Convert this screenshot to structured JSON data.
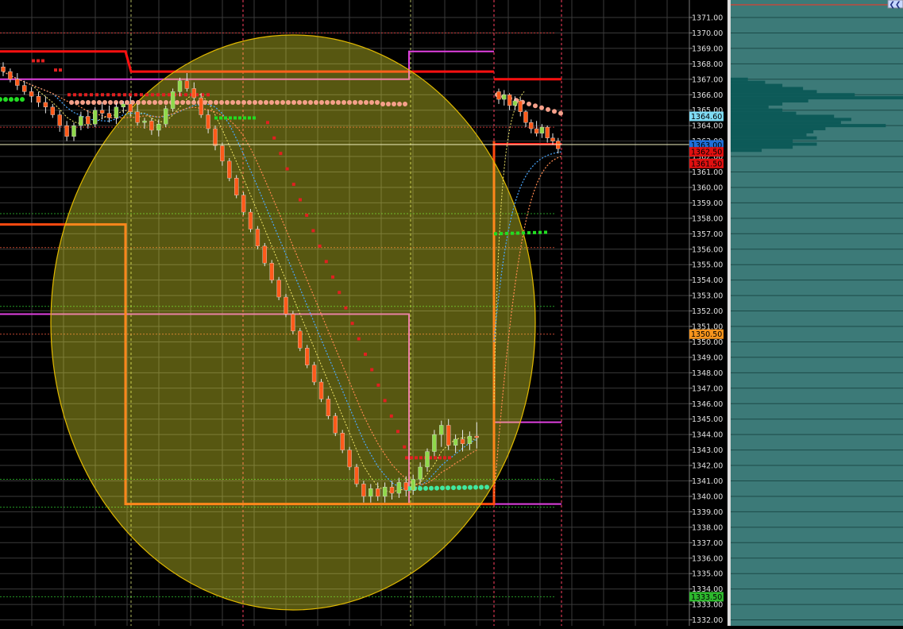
{
  "chart_data": {
    "type": "candlestick",
    "y_axis": {
      "min": 1332.0,
      "max": 1371.0,
      "tick_step": 1.0,
      "position": "right",
      "tick_labels": [
        "1371.00",
        "1370.00",
        "1369.00",
        "1368.00",
        "1367.00",
        "1366.00",
        "1365.00",
        "1364.00",
        "1363.00",
        "1362.00",
        "1361.00",
        "1360.00",
        "1359.00",
        "1358.00",
        "1357.00",
        "1356.00",
        "1355.00",
        "1354.00",
        "1353.00",
        "1352.00",
        "1351.00",
        "1350.00",
        "1349.00",
        "1348.00",
        "1347.00",
        "1346.00",
        "1345.00",
        "1344.00",
        "1343.00",
        "1342.00",
        "1341.00",
        "1340.00",
        "1339.00",
        "1338.00",
        "1337.00",
        "1336.00",
        "1335.00",
        "1334.00",
        "1333.00",
        "1332.00"
      ]
    },
    "grid": true,
    "price_markers": [
      {
        "label": "1364.60",
        "value": 1364.6,
        "color": "#7fdcf5",
        "text_color": "#000000"
      },
      {
        "label": "1363.00",
        "value": 1362.75,
        "color": "#1e6fd9",
        "text_color": "#000000"
      },
      {
        "label": "1362.50",
        "value": 1362.3,
        "color": "#e01010",
        "text_color": "#000000"
      },
      {
        "label": "1361.50",
        "value": 1361.55,
        "color": "#e01010",
        "text_color": "#000000"
      },
      {
        "label": "1350.50",
        "value": 1350.5,
        "color": "#f7941d",
        "text_color": "#000000"
      },
      {
        "label": "1333.50",
        "value": 1333.5,
        "color": "#2db82d",
        "text_color": "#000000"
      }
    ],
    "candles": [
      {
        "o": 1367.8,
        "h": 1368.1,
        "l": 1367.2,
        "c": 1367.5
      },
      {
        "o": 1367.5,
        "h": 1367.7,
        "l": 1366.8,
        "c": 1367.0
      },
      {
        "o": 1367.0,
        "h": 1367.4,
        "l": 1366.3,
        "c": 1366.6
      },
      {
        "o": 1366.6,
        "h": 1366.9,
        "l": 1366.0,
        "c": 1366.2
      },
      {
        "o": 1366.2,
        "h": 1366.5,
        "l": 1365.5,
        "c": 1365.9
      },
      {
        "o": 1365.9,
        "h": 1366.2,
        "l": 1365.2,
        "c": 1365.5
      },
      {
        "o": 1365.5,
        "h": 1365.9,
        "l": 1364.8,
        "c": 1365.2
      },
      {
        "o": 1365.2,
        "h": 1365.4,
        "l": 1364.5,
        "c": 1364.7
      },
      {
        "o": 1364.7,
        "h": 1365.0,
        "l": 1363.6,
        "c": 1364.0
      },
      {
        "o": 1364.0,
        "h": 1364.3,
        "l": 1363.0,
        "c": 1363.3
      },
      {
        "o": 1363.3,
        "h": 1364.2,
        "l": 1363.0,
        "c": 1364.0
      },
      {
        "o": 1364.0,
        "h": 1364.9,
        "l": 1363.7,
        "c": 1364.6
      },
      {
        "o": 1364.6,
        "h": 1365.0,
        "l": 1363.8,
        "c": 1364.1
      },
      {
        "o": 1364.1,
        "h": 1365.2,
        "l": 1363.9,
        "c": 1365.0
      },
      {
        "o": 1365.0,
        "h": 1365.5,
        "l": 1364.4,
        "c": 1364.8
      },
      {
        "o": 1364.8,
        "h": 1365.3,
        "l": 1364.2,
        "c": 1364.5
      },
      {
        "o": 1364.5,
        "h": 1365.5,
        "l": 1364.1,
        "c": 1365.2
      },
      {
        "o": 1365.2,
        "h": 1365.6,
        "l": 1364.8,
        "c": 1365.4
      },
      {
        "o": 1365.4,
        "h": 1365.9,
        "l": 1364.6,
        "c": 1364.9
      },
      {
        "o": 1364.9,
        "h": 1365.4,
        "l": 1364.0,
        "c": 1364.2
      },
      {
        "o": 1364.2,
        "h": 1364.5,
        "l": 1363.8,
        "c": 1364.3
      },
      {
        "o": 1364.3,
        "h": 1364.5,
        "l": 1363.4,
        "c": 1363.7
      },
      {
        "o": 1363.7,
        "h": 1364.4,
        "l": 1363.3,
        "c": 1364.1
      },
      {
        "o": 1364.1,
        "h": 1365.3,
        "l": 1363.9,
        "c": 1365.1
      },
      {
        "o": 1365.1,
        "h": 1366.4,
        "l": 1364.9,
        "c": 1366.2
      },
      {
        "o": 1366.2,
        "h": 1367.1,
        "l": 1365.9,
        "c": 1366.9
      },
      {
        "o": 1366.9,
        "h": 1367.4,
        "l": 1366.2,
        "c": 1366.4
      },
      {
        "o": 1366.4,
        "h": 1366.8,
        "l": 1365.6,
        "c": 1365.8
      },
      {
        "o": 1365.8,
        "h": 1366.1,
        "l": 1364.5,
        "c": 1364.7
      },
      {
        "o": 1364.7,
        "h": 1365.0,
        "l": 1363.5,
        "c": 1363.8
      },
      {
        "o": 1363.8,
        "h": 1364.0,
        "l": 1362.4,
        "c": 1362.7
      },
      {
        "o": 1362.7,
        "h": 1362.9,
        "l": 1361.4,
        "c": 1361.7
      },
      {
        "o": 1361.7,
        "h": 1361.9,
        "l": 1360.4,
        "c": 1360.6
      },
      {
        "o": 1360.6,
        "h": 1360.8,
        "l": 1359.3,
        "c": 1359.5
      },
      {
        "o": 1359.5,
        "h": 1359.7,
        "l": 1358.2,
        "c": 1358.4
      },
      {
        "o": 1358.4,
        "h": 1358.6,
        "l": 1357.1,
        "c": 1357.3
      },
      {
        "o": 1357.3,
        "h": 1357.5,
        "l": 1356.0,
        "c": 1356.2
      },
      {
        "o": 1356.2,
        "h": 1356.4,
        "l": 1354.9,
        "c": 1355.1
      },
      {
        "o": 1355.1,
        "h": 1355.3,
        "l": 1353.8,
        "c": 1354.0
      },
      {
        "o": 1354.0,
        "h": 1354.2,
        "l": 1352.7,
        "c": 1352.9
      },
      {
        "o": 1352.9,
        "h": 1353.1,
        "l": 1351.6,
        "c": 1351.8
      },
      {
        "o": 1351.8,
        "h": 1352.0,
        "l": 1350.5,
        "c": 1350.7
      },
      {
        "o": 1350.7,
        "h": 1350.9,
        "l": 1349.4,
        "c": 1349.6
      },
      {
        "o": 1349.6,
        "h": 1349.8,
        "l": 1348.3,
        "c": 1348.5
      },
      {
        "o": 1348.5,
        "h": 1348.7,
        "l": 1347.2,
        "c": 1347.4
      },
      {
        "o": 1347.4,
        "h": 1347.6,
        "l": 1346.1,
        "c": 1346.3
      },
      {
        "o": 1346.3,
        "h": 1346.5,
        "l": 1345.0,
        "c": 1345.2
      },
      {
        "o": 1345.2,
        "h": 1345.4,
        "l": 1343.9,
        "c": 1344.1
      },
      {
        "o": 1344.1,
        "h": 1344.3,
        "l": 1342.8,
        "c": 1343.0
      },
      {
        "o": 1343.0,
        "h": 1343.2,
        "l": 1341.7,
        "c": 1341.9
      },
      {
        "o": 1341.9,
        "h": 1342.1,
        "l": 1340.6,
        "c": 1340.8
      },
      {
        "o": 1340.8,
        "h": 1341.0,
        "l": 1339.6,
        "c": 1340.0
      },
      {
        "o": 1340.0,
        "h": 1340.8,
        "l": 1339.6,
        "c": 1340.5
      },
      {
        "o": 1340.5,
        "h": 1340.9,
        "l": 1339.7,
        "c": 1340.0
      },
      {
        "o": 1340.0,
        "h": 1340.9,
        "l": 1339.6,
        "c": 1340.6
      },
      {
        "o": 1340.6,
        "h": 1341.0,
        "l": 1339.8,
        "c": 1340.2
      },
      {
        "o": 1340.2,
        "h": 1341.2,
        "l": 1339.9,
        "c": 1340.9
      },
      {
        "o": 1340.9,
        "h": 1341.3,
        "l": 1340.0,
        "c": 1340.4
      },
      {
        "o": 1340.4,
        "h": 1341.4,
        "l": 1340.1,
        "c": 1341.1
      },
      {
        "o": 1341.1,
        "h": 1342.2,
        "l": 1340.8,
        "c": 1341.9
      },
      {
        "o": 1341.9,
        "h": 1343.1,
        "l": 1341.6,
        "c": 1342.9
      },
      {
        "o": 1342.9,
        "h": 1344.3,
        "l": 1342.6,
        "c": 1344.0
      },
      {
        "o": 1344.0,
        "h": 1344.9,
        "l": 1343.2,
        "c": 1344.6
      },
      {
        "o": 1344.6,
        "h": 1345.0,
        "l": 1343.0,
        "c": 1343.3
      },
      {
        "o": 1343.3,
        "h": 1344.0,
        "l": 1342.8,
        "c": 1343.7
      },
      {
        "o": 1343.7,
        "h": 1344.3,
        "l": 1342.9,
        "c": 1343.4
      },
      {
        "o": 1343.4,
        "h": 1344.2,
        "l": 1343.0,
        "c": 1343.9
      },
      {
        "o": 1343.9,
        "h": 1344.8,
        "l": 1343.1,
        "c": 1343.8
      },
      {
        "o": 1366.2,
        "h": 1366.4,
        "l": 1365.4,
        "c": 1365.7
      },
      {
        "o": 1365.7,
        "h": 1366.3,
        "l": 1365.3,
        "c": 1366.0
      },
      {
        "o": 1366.0,
        "h": 1366.1,
        "l": 1365.0,
        "c": 1365.3
      },
      {
        "o": 1365.3,
        "h": 1365.9,
        "l": 1365.0,
        "c": 1365.6
      },
      {
        "o": 1365.6,
        "h": 1365.8,
        "l": 1364.6,
        "c": 1364.9
      },
      {
        "o": 1364.9,
        "h": 1365.0,
        "l": 1363.9,
        "c": 1364.2
      },
      {
        "o": 1364.2,
        "h": 1364.4,
        "l": 1363.5,
        "c": 1363.8
      },
      {
        "o": 1363.8,
        "h": 1364.3,
        "l": 1363.3,
        "c": 1363.5
      },
      {
        "o": 1363.5,
        "h": 1364.1,
        "l": 1363.2,
        "c": 1363.9
      },
      {
        "o": 1363.9,
        "h": 1364.0,
        "l": 1362.9,
        "c": 1363.2
      },
      {
        "o": 1363.2,
        "h": 1363.5,
        "l": 1362.8,
        "c": 1363.0
      },
      {
        "o": 1363.0,
        "h": 1363.2,
        "l": 1362.2,
        "c": 1362.5
      }
    ],
    "volume_profile": [
      {
        "price": 1367.0,
        "volume": 0.1
      },
      {
        "price": 1366.8,
        "volume": 0.2
      },
      {
        "price": 1366.6,
        "volume": 0.3
      },
      {
        "price": 1366.4,
        "volume": 0.42
      },
      {
        "price": 1366.2,
        "volume": 0.5
      },
      {
        "price": 1366.0,
        "volume": 0.72
      },
      {
        "price": 1365.8,
        "volume": 1.0
      },
      {
        "price": 1365.6,
        "volume": 0.45
      },
      {
        "price": 1365.4,
        "volume": 0.3
      },
      {
        "price": 1365.2,
        "volume": 0.22
      },
      {
        "price": 1365.0,
        "volume": 0.3
      },
      {
        "price": 1364.8,
        "volume": 0.38
      },
      {
        "price": 1364.6,
        "volume": 0.6
      },
      {
        "price": 1364.4,
        "volume": 0.7
      },
      {
        "price": 1364.2,
        "volume": 0.64
      },
      {
        "price": 1364.0,
        "volume": 0.9
      },
      {
        "price": 1363.8,
        "volume": 0.55
      },
      {
        "price": 1363.6,
        "volume": 0.48
      },
      {
        "price": 1363.4,
        "volume": 0.44
      },
      {
        "price": 1363.2,
        "volume": 0.5
      },
      {
        "price": 1363.0,
        "volume": 0.36
      },
      {
        "price": 1362.8,
        "volume": 0.5
      },
      {
        "price": 1362.6,
        "volume": 0.36
      },
      {
        "price": 1362.4,
        "volume": 0.18
      }
    ]
  },
  "header": {
    "collapse_glyph": "❮❮"
  },
  "colors": {
    "background": "#000000",
    "grid": "#3a3a3a",
    "up_candle": "#8fd94a",
    "down_candle": "#ff5a1a",
    "highlight_fill": "#ffff32",
    "highlight_stroke": "#e0b800",
    "level_red": "#ff1010",
    "level_magenta": "#e040e0",
    "level_orange": "#ff4a10",
    "dot_salmon": "#f5a08a",
    "dot_red": "#e02020",
    "dot_green": "#22dd22",
    "ma_blue": "#4aa8ff",
    "ma_orange": "#ff8a50",
    "ma_yellow": "#f4e86a",
    "panel_bg": "#3c7a78",
    "panel_bar": "#0d5a58"
  }
}
